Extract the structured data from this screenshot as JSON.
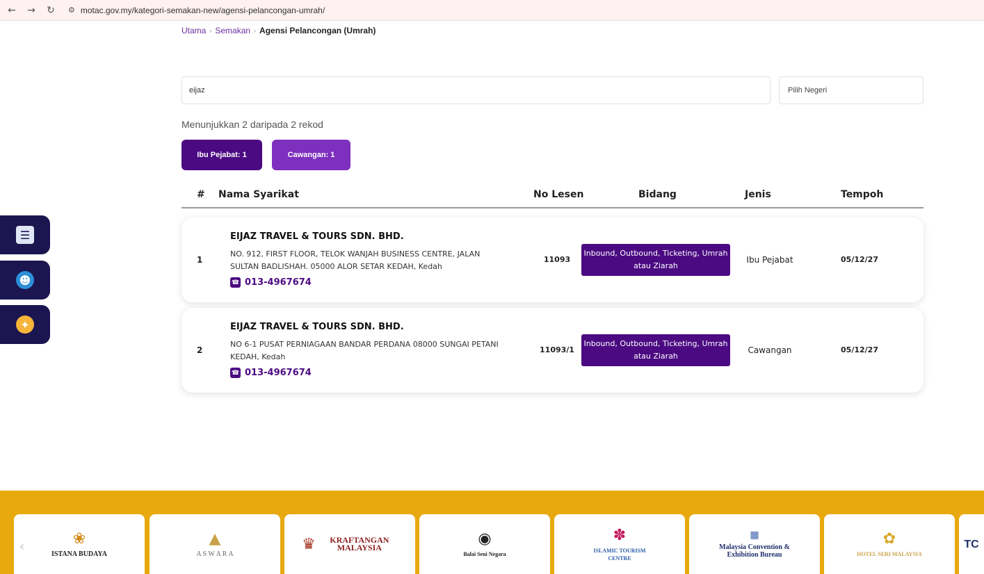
{
  "browser": {
    "url": "motac.gov.my/kategori-semakan-new/agensi-pelancongan-umrah/"
  },
  "breadcrumb": {
    "items": [
      "Utama",
      "Semakan"
    ],
    "current": "Agensi Pelancongan (Umrah)"
  },
  "search": {
    "value": "eijaz",
    "state_placeholder": "Pilih Negeri"
  },
  "results_text": "Menunjukkan 2 daripada 2 rekod",
  "filters": {
    "hq": "Ibu Pejabat: 1",
    "branch": "Cawangan: 1"
  },
  "table": {
    "headers": {
      "num": "#",
      "name": "Nama Syarikat",
      "license": "No Lesen",
      "field": "Bidang",
      "type": "Jenis",
      "expiry": "Tempoh"
    },
    "rows": [
      {
        "num": "1",
        "name": "EIJAZ TRAVEL & TOURS SDN. BHD.",
        "address": "NO. 912, FIRST FLOOR, TELOK WANJAH BUSINESS CENTRE, JALAN SULTAN BADLISHAH. 05000 ALOR SETAR KEDAH, Kedah",
        "phone": "013-4967674",
        "license": "11093",
        "field": "Inbound, Outbound, Ticketing, Umrah atau Ziarah",
        "type": "Ibu Pejabat",
        "expiry": "05/12/27"
      },
      {
        "num": "2",
        "name": "EIJAZ TRAVEL & TOURS SDN. BHD.",
        "address": "NO 6-1 PUSAT PERNIAGAAN BANDAR PERDANA 08000 SUNGAI PETANI KEDAH, Kedah",
        "phone": "013-4967674",
        "license": "11093/1",
        "field": "Inbound, Outbound, Ticketing, Umrah atau Ziarah",
        "type": "Cawangan",
        "expiry": "05/12/27"
      }
    ]
  },
  "footer_logos": [
    {
      "text": "ISTANA BUDAYA",
      "icon": "lotus-icon"
    },
    {
      "text": "A S W A R A",
      "icon": "aswara-icon"
    },
    {
      "text": "KRAFTANGAN MALAYSIA",
      "icon": "kraftangan-icon"
    },
    {
      "text": "Balai Seni Negara",
      "icon": "eye-icon"
    },
    {
      "text": "ISLAMIC TOURISM CENTRE",
      "icon": "itc-icon"
    },
    {
      "text": "Malaysia Convention & Exhibition Bureau",
      "icon": "myceb-icon"
    },
    {
      "text": "HOTEL SERI MALAYSIA",
      "icon": "flower-icon"
    }
  ],
  "colors": {
    "primary": "#4b0a82",
    "secondary": "#7d2fbd",
    "footer": "#e8a90e",
    "side": "#1b1550"
  }
}
